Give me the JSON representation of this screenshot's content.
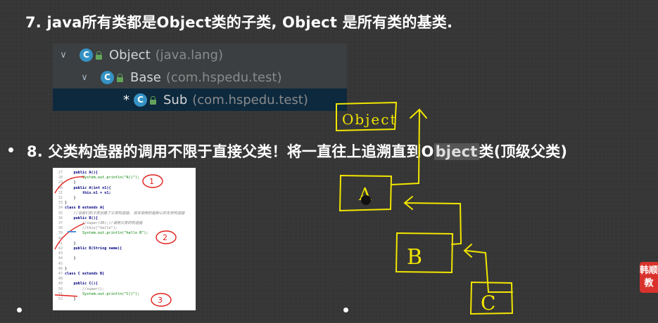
{
  "slide": {
    "item7": {
      "number": "7.",
      "text": "java所有类都是Object类的子类, Object 是所有类的基类."
    },
    "item8": {
      "number": "8.",
      "text_a": "父类构造器的调用不限于直接父类！将一直往上追溯直到O",
      "text_hl": "bject",
      "text_b": "类(顶级父类)"
    }
  },
  "hierarchy": {
    "rows": [
      {
        "name": "Object",
        "package": "(java.lang)"
      },
      {
        "name": "Base",
        "package": "(com.hspedu.test)"
      },
      {
        "name": "Sub",
        "package": "(com.hspedu.test)",
        "marker": "*"
      }
    ],
    "icon_letter": "C"
  },
  "code": {
    "lines": [
      {
        "n": "27",
        "t": "    public A(){"
      },
      {
        "n": "28",
        "t": "        System.out.println(\"A()\");"
      },
      {
        "n": "29",
        "t": "    }"
      },
      {
        "n": "30",
        "t": "    public A(int n1){"
      },
      {
        "n": "31",
        "t": "        this.n1 = n1;"
      },
      {
        "n": "32",
        "t": "    }"
      },
      {
        "n": "33",
        "t": "}"
      },
      {
        "n": "34",
        "t": "class B extends A{"
      },
      {
        "n": "35",
        "t": "    //当我们的子类创建了父类构造器, 其实使用的是默认的无参构造器"
      },
      {
        "n": "36",
        "t": "    public B(){"
      },
      {
        "n": "37",
        "t": "        //super(30);//调用父类的构造器"
      },
      {
        "n": "38",
        "t": "        //this(\"hello\");"
      },
      {
        "n": "39",
        "t": "        System.out.println(\"hello B\");"
      },
      {
        "n": "40",
        "t": ""
      },
      {
        "n": "41",
        "t": "    }"
      },
      {
        "n": "42",
        "t": "    public B(String name){"
      },
      {
        "n": "43",
        "t": ""
      },
      {
        "n": "44",
        "t": "    }"
      },
      {
        "n": "45",
        "t": ""
      },
      {
        "n": "46",
        "t": "}"
      },
      {
        "n": "47",
        "t": "class C extends B{"
      },
      {
        "n": "48",
        "t": ""
      },
      {
        "n": "49",
        "t": "    public C(){"
      },
      {
        "n": "50",
        "t": "        //super();"
      },
      {
        "n": "51",
        "t": "        System.out.println(\"C()\");"
      },
      {
        "n": "52",
        "t": "    }"
      }
    ],
    "annotations": [
      "1",
      "2",
      "3"
    ]
  },
  "sketch": {
    "boxes": [
      "Object",
      "A",
      "B",
      "C"
    ],
    "color": "#f2e600"
  },
  "corner_tag": {
    "line1": "韩顺",
    "line2": "教"
  },
  "colors": {
    "background": "#363636",
    "tree_bg": "#3b3f41",
    "tree_selected": "#0d293e",
    "class_icon": "#3592c4",
    "annotation_red": "#e0201c"
  }
}
